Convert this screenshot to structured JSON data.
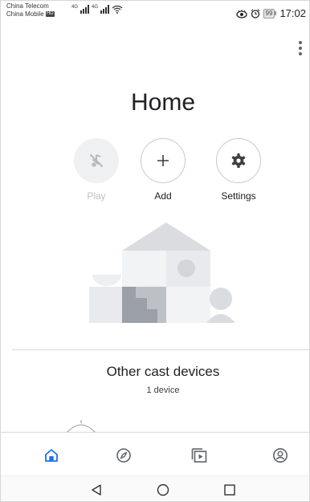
{
  "status_bar": {
    "carrier_1": "China Telecom",
    "carrier_2": "China Mobile",
    "carrier_2_badge": "HD",
    "signal_label": "4G",
    "battery": "99",
    "time": "17:02"
  },
  "page": {
    "title": "Home"
  },
  "actions": {
    "play_label": "Play",
    "add_label": "Add",
    "settings_label": "Settings"
  },
  "devices": {
    "title": "Other cast devices",
    "count": "1 device"
  },
  "colors": {
    "accent": "#1a73e8",
    "icon": "#5f6368",
    "disabled": "#bdc1c6"
  },
  "icons": {
    "status": [
      "signal-icon",
      "wifi-icon",
      "eye-icon",
      "alarm-icon",
      "battery-icon"
    ],
    "actions": [
      "play-disabled-icon",
      "plus-icon",
      "gear-icon"
    ],
    "bottom_nav": [
      "home-icon",
      "compass-icon",
      "media-icon",
      "account-icon"
    ],
    "system_nav": [
      "back-icon",
      "home-circle-icon",
      "recents-icon"
    ]
  }
}
